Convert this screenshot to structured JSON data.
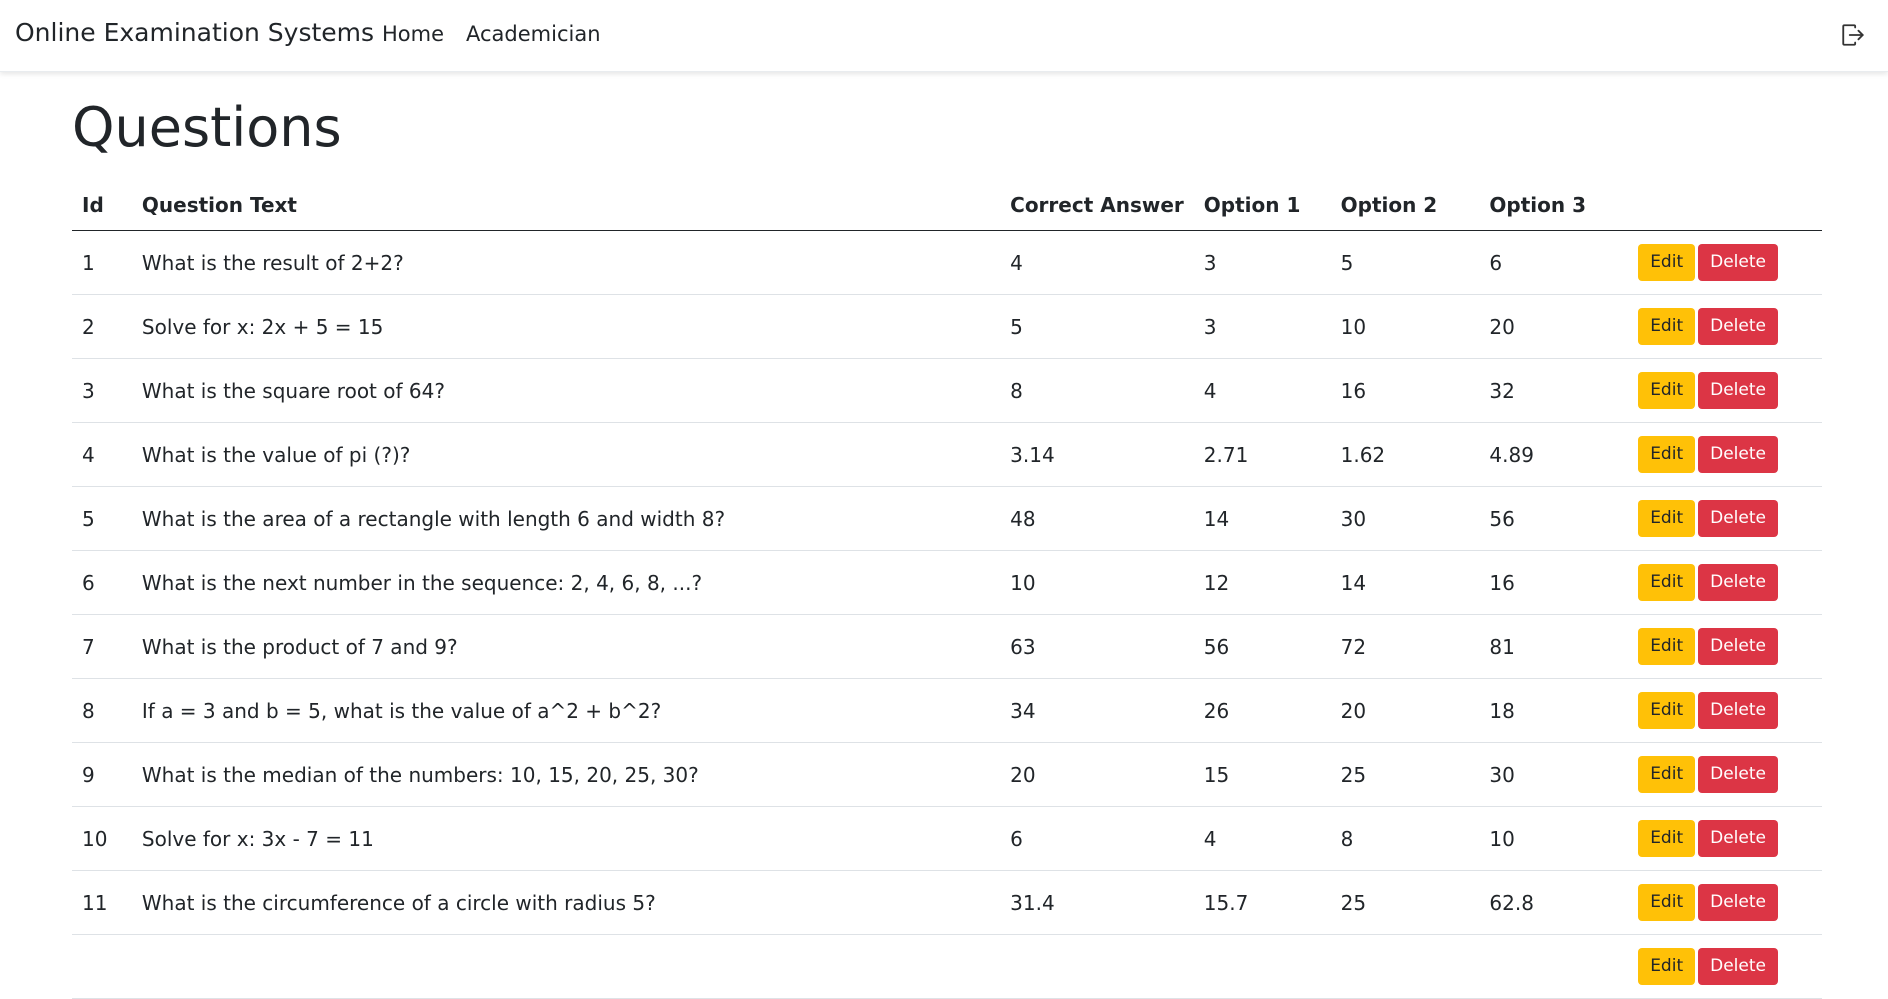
{
  "navbar": {
    "brand": "Online Examination Systems",
    "links": [
      "Home",
      "Academician"
    ],
    "logout_icon": "logout-icon"
  },
  "page": {
    "title": "Questions"
  },
  "table": {
    "headers": [
      "Id",
      "Question Text",
      "Correct Answer",
      "Option 1",
      "Option 2",
      "Option 3",
      ""
    ],
    "edit_label": "Edit",
    "delete_label": "Delete",
    "rows": [
      {
        "id": "1",
        "text": "What is the result of 2+2?",
        "correct": "4",
        "opt1": "3",
        "opt2": "5",
        "opt3": "6"
      },
      {
        "id": "2",
        "text": "Solve for x: 2x + 5 = 15",
        "correct": "5",
        "opt1": "3",
        "opt2": "10",
        "opt3": "20"
      },
      {
        "id": "3",
        "text": "What is the square root of 64?",
        "correct": "8",
        "opt1": "4",
        "opt2": "16",
        "opt3": "32"
      },
      {
        "id": "4",
        "text": "What is the value of pi (?)?",
        "correct": "3.14",
        "opt1": "2.71",
        "opt2": "1.62",
        "opt3": "4.89"
      },
      {
        "id": "5",
        "text": "What is the area of a rectangle with length 6 and width 8?",
        "correct": "48",
        "opt1": "14",
        "opt2": "30",
        "opt3": "56"
      },
      {
        "id": "6",
        "text": "What is the next number in the sequence: 2, 4, 6, 8, ...?",
        "correct": "10",
        "opt1": "12",
        "opt2": "14",
        "opt3": "16"
      },
      {
        "id": "7",
        "text": "What is the product of 7 and 9?",
        "correct": "63",
        "opt1": "56",
        "opt2": "72",
        "opt3": "81"
      },
      {
        "id": "8",
        "text": "If a = 3 and b = 5, what is the value of a^2 + b^2?",
        "correct": "34",
        "opt1": "26",
        "opt2": "20",
        "opt3": "18"
      },
      {
        "id": "9",
        "text": "What is the median of the numbers: 10, 15, 20, 25, 30?",
        "correct": "20",
        "opt1": "15",
        "opt2": "25",
        "opt3": "30"
      },
      {
        "id": "10",
        "text": "Solve for x: 3x - 7 = 11",
        "correct": "6",
        "opt1": "4",
        "opt2": "8",
        "opt3": "10"
      },
      {
        "id": "11",
        "text": "What is the circumference of a circle with radius 5?",
        "correct": "31.4",
        "opt1": "15.7",
        "opt2": "25",
        "opt3": "62.8"
      },
      {
        "id": "",
        "text": "",
        "correct": "",
        "opt1": "",
        "opt2": "",
        "opt3": ""
      }
    ]
  },
  "colors": {
    "edit_button": "#ffc107",
    "delete_button": "#dc3545"
  }
}
